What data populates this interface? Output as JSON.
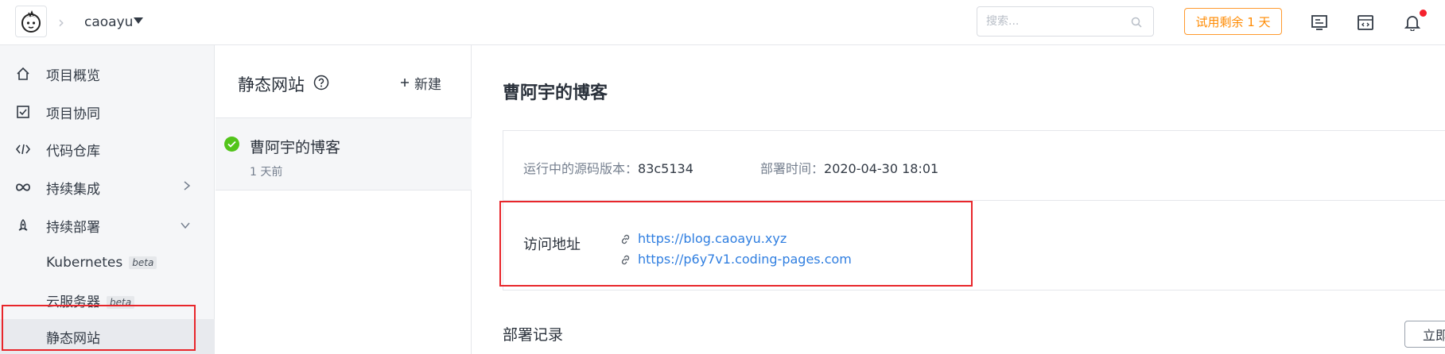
{
  "topbar": {
    "logo_icon": "coding-mascot-icon",
    "project_name": "caoayu",
    "search_placeholder": "搜索...",
    "trial_label": "试用剩余 1 天",
    "icons": [
      "tasks-icon",
      "calendar-icon",
      "bell-icon"
    ]
  },
  "sidebar": {
    "items": [
      {
        "label": "项目概览",
        "icon": "home-icon"
      },
      {
        "label": "项目协同",
        "icon": "checkbox-icon"
      },
      {
        "label": "代码仓库",
        "icon": "code-icon"
      },
      {
        "label": "持续集成",
        "icon": "infinity-icon"
      },
      {
        "label": "持续部署",
        "icon": "rocket-icon"
      },
      {
        "label": "Kubernetes",
        "badge": "beta"
      },
      {
        "label": "云服务器",
        "badge": "beta"
      },
      {
        "label": "静态网站"
      }
    ]
  },
  "sites_panel": {
    "title": "静态网站",
    "new_label": "新建",
    "site": {
      "name": "曹阿宇的博客",
      "time": "1 天前"
    }
  },
  "main": {
    "title": "曹阿宇的博客",
    "source_version_label": "运行中的源码版本：",
    "source_version": "83c5134",
    "deploy_time_label": "部署时间：",
    "deploy_time": "2020-04-30 18:01",
    "visit_label": "访问地址",
    "links": [
      "https://blog.caoayu.xyz",
      "https://p6y7v1.coding-pages.com"
    ],
    "deploy_records_label": "部署记录",
    "now_button": "立即"
  },
  "colors": {
    "accent_link": "#2f7ee0",
    "trial_orange": "#ff8a00",
    "highlight_red": "#e8262b",
    "success_green": "#52c41a"
  }
}
